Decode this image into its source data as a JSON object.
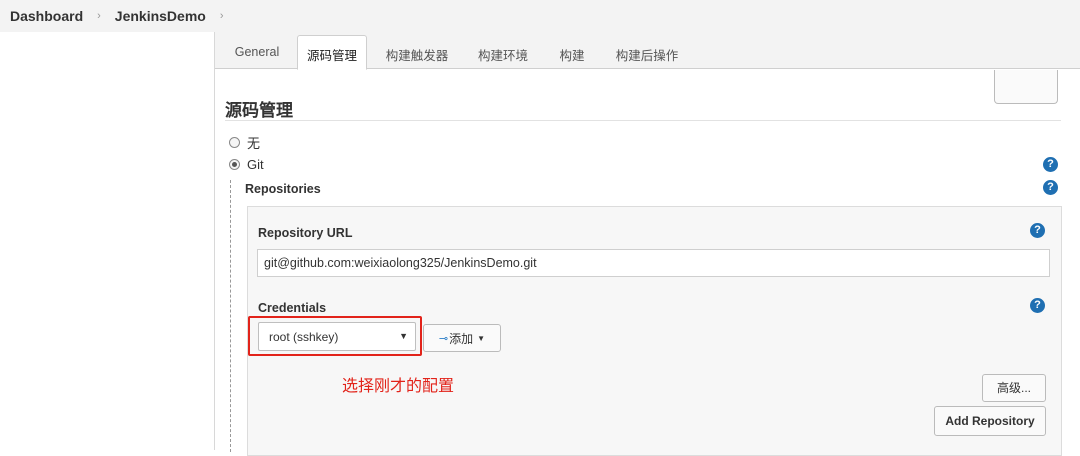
{
  "breadcrumb": {
    "items": [
      "Dashboard",
      "JenkinsDemo"
    ],
    "separator": "›"
  },
  "tabs": [
    {
      "label": "General",
      "active": false
    },
    {
      "label": "源码管理",
      "active": true
    },
    {
      "label": "构建触发器",
      "active": false
    },
    {
      "label": "构建环境",
      "active": false
    },
    {
      "label": "构建",
      "active": false
    },
    {
      "label": "构建后操作",
      "active": false
    }
  ],
  "scm": {
    "title": "源码管理",
    "options": [
      {
        "label": "无",
        "checked": false
      },
      {
        "label": "Git",
        "checked": true
      }
    ],
    "repositories_label": "Repositories",
    "repository_url_label": "Repository URL",
    "repository_url_value": "git@github.com:weixiaolong325/JenkinsDemo.git",
    "credentials_label": "Credentials",
    "credentials_selected": "root (sshkey)",
    "add_button_label": "添加",
    "advanced_button_label": "高级...",
    "add_repository_label": "Add Repository"
  },
  "annotation": {
    "text": "选择刚才的配置",
    "color": "#e2231a"
  },
  "icons": {
    "help": "?",
    "select_arrow": "▼",
    "dropdown_caret": "▼",
    "key": "⊸"
  },
  "colors": {
    "help_blue": "#1f6fb2",
    "highlight_red": "#e2231a"
  }
}
